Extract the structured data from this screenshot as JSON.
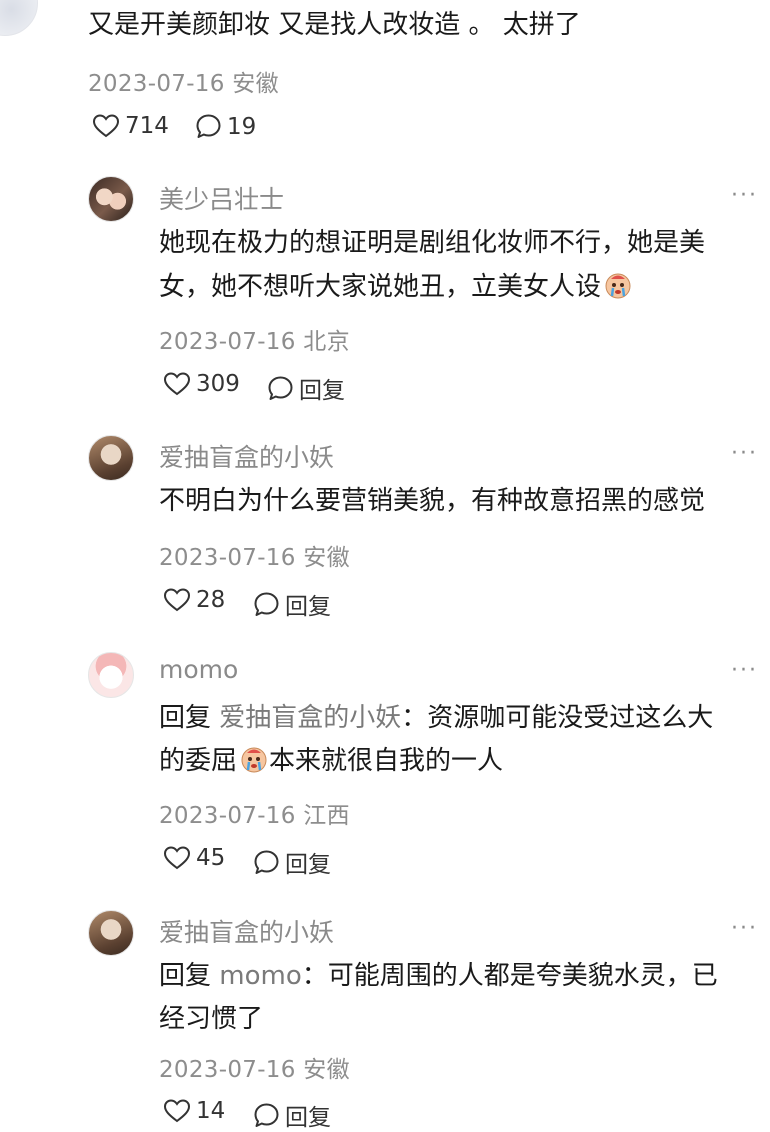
{
  "top_comment": {
    "text": "又是开美颜卸妆 又是找人改妆造 。 太拼了",
    "date": "2023-07-16",
    "location": "安徽",
    "likes": "714",
    "replies": "19"
  },
  "replies": [
    {
      "name": "美少吕壮士",
      "line1": "她现在极力的想证明是剧组化妆师不行，她是美",
      "line2": "女，她不想听大家说她丑，立美女人设",
      "date": "2023-07-16",
      "location": "北京",
      "likes": "309",
      "reply_label": "回复",
      "emoji": "crying-face-emoji"
    },
    {
      "name": "爱抽盲盒的小妖",
      "line1": "不明白为什么要营销美貌，有种故意招黑的感觉",
      "date": "2023-07-16",
      "location": "安徽",
      "likes": "28",
      "reply_label": "回复"
    },
    {
      "name": "momo",
      "reply_prefix": "回复",
      "mention": "爱抽盲盒的小妖",
      "line1_rest": "：资源咖可能没受过这么大",
      "line2_a": "的委屈",
      "line2_b": "本来就很自我的一人",
      "date": "2023-07-16",
      "location": "江西",
      "likes": "45",
      "reply_label": "回复",
      "emoji": "crying-face-emoji"
    },
    {
      "name": "爱抽盲盒的小妖",
      "reply_prefix": "回复",
      "mention": "momo",
      "line1_rest": "：可能周围的人都是夸美貌水灵，已",
      "line2": "经习惯了",
      "date": "2023-07-16",
      "location": "安徽",
      "likes": "14",
      "reply_label": "回复"
    }
  ],
  "more_glyph": "···",
  "colors": {
    "text": "#1a1a1a",
    "meta": "#8d8d8d",
    "icon": "#333333"
  }
}
